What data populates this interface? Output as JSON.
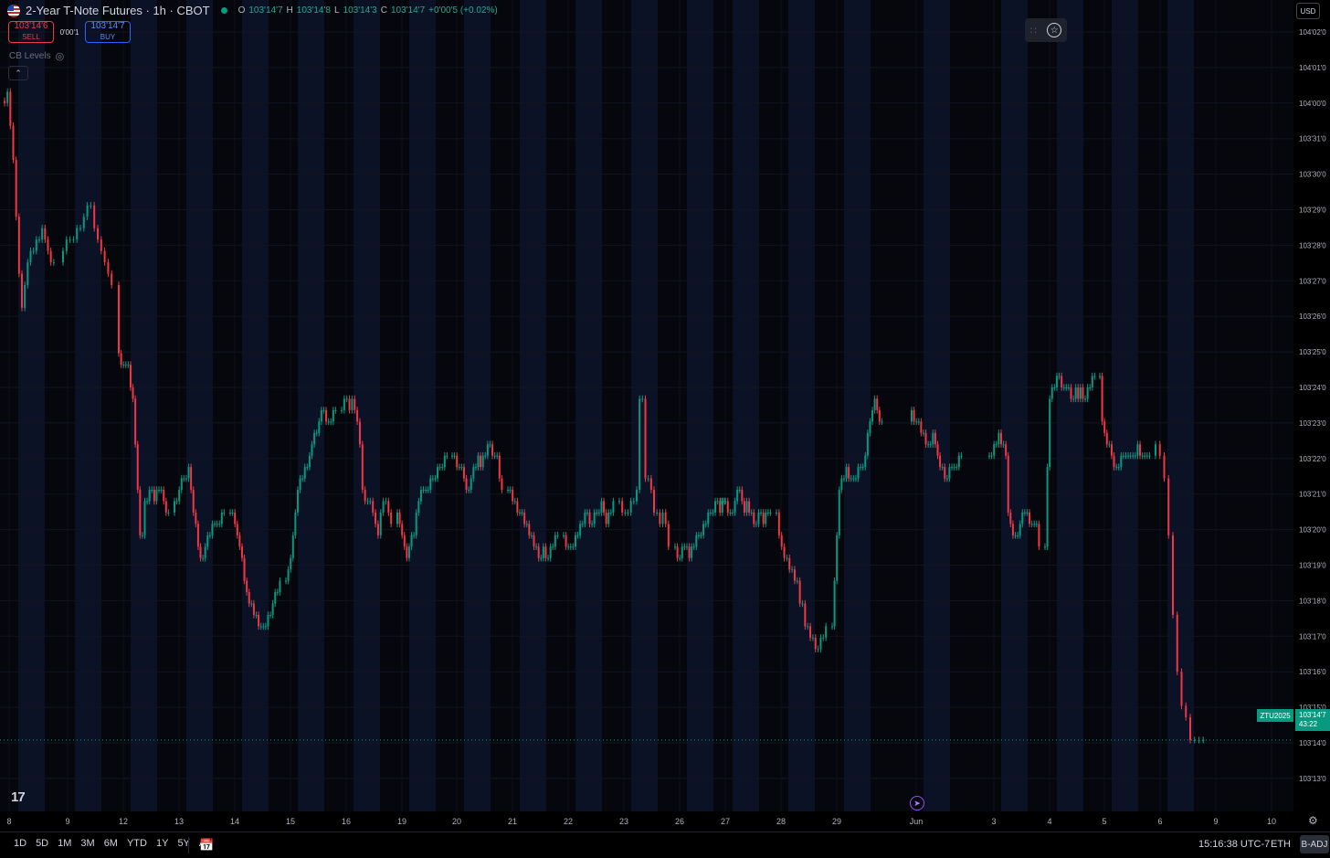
{
  "symbol": {
    "title": "2-Year T-Note Futures · 1h · CBOT",
    "ohlc": [
      {
        "label": "O",
        "value": "103'14'7"
      },
      {
        "label": "H",
        "value": "103'14'8"
      },
      {
        "label": "L",
        "value": "103'14'3"
      },
      {
        "label": "C",
        "value": "103'14'7"
      },
      {
        "label": "",
        "value": "+0'00'5 (+0.02%)"
      }
    ]
  },
  "trade": {
    "sell_price": "103'14'6",
    "sell_label": "SELL",
    "spread": "0'00'1",
    "buy_price": "103'14'7",
    "buy_label": "BUY"
  },
  "indicator": {
    "name": "CB Levels"
  },
  "currency": "USD",
  "tv_logo": "17",
  "last_price": {
    "ticker": "ZTU2025",
    "price": "103'14'7",
    "countdown": "43:22"
  },
  "bottom_bar": {
    "ranges": [
      "1D",
      "5D",
      "1M",
      "3M",
      "6M",
      "YTD",
      "1Y",
      "5Y",
      "All"
    ],
    "clock": "15:16:38 UTC-7",
    "session": "ETH",
    "adjust": "B-ADJ"
  },
  "colors": {
    "up": "#089981",
    "down": "#f23645",
    "background": "#05070d",
    "session_band": "#0b1226"
  },
  "chart_data": {
    "type": "candlestick",
    "timeframe": "1h",
    "y_ticks": [
      "104'02'0",
      "104'01'0",
      "104'00'0",
      "103'31'0",
      "103'30'0",
      "103'29'0",
      "103'28'0",
      "103'27'0",
      "103'26'0",
      "103'25'0",
      "103'24'0",
      "103'23'0",
      "103'22'0",
      "103'21'0",
      "103'20'0",
      "103'19'0",
      "103'18'0",
      "103'17'0",
      "103'16'0",
      "103'15'0",
      "103'14'0",
      "103'13'0"
    ],
    "x_ticks": [
      "8",
      "9",
      "12",
      "13",
      "14",
      "15",
      "16",
      "19",
      "20",
      "21",
      "22",
      "23",
      "26",
      "27",
      "28",
      "29",
      "Jun",
      "3",
      "4",
      "5",
      "6",
      "9",
      "10"
    ],
    "ylim": [
      103.375,
      104.09
    ],
    "grid": true,
    "price_series": [
      {
        "day": "8",
        "points": [
          104.0,
          104.01,
          103.98,
          103.95,
          103.9,
          103.85,
          103.82,
          103.84,
          103.86,
          103.87,
          103.87,
          103.88,
          103.88,
          103.89,
          103.88,
          103.87,
          103.86,
          103.86
        ]
      },
      {
        "day": "9",
        "points": [
          103.87,
          103.88,
          103.88,
          103.88,
          103.89,
          103.89,
          103.9,
          103.91,
          103.91,
          103.89,
          103.88,
          103.87,
          103.86,
          103.85,
          103.84
        ]
      },
      {
        "day": "12",
        "points": [
          103.78,
          103.77,
          103.77,
          103.77,
          103.77,
          103.75,
          103.74,
          103.7,
          103.66,
          103.62,
          103.62,
          103.65,
          103.65,
          103.66,
          103.66,
          103.65,
          103.66,
          103.66,
          103.66,
          103.65,
          103.64,
          103.64
        ]
      },
      {
        "day": "13",
        "points": [
          103.65,
          103.65,
          103.66,
          103.67,
          103.67,
          103.67,
          103.68,
          103.66,
          103.64,
          103.63,
          103.61,
          103.6,
          103.6,
          103.61,
          103.62,
          103.62,
          103.63,
          103.63,
          103.63,
          103.63,
          103.64,
          103.64
        ]
      },
      {
        "day": "14",
        "points": [
          103.64,
          103.64,
          103.63,
          103.62,
          103.61,
          103.6,
          103.58,
          103.57,
          103.56,
          103.56,
          103.55,
          103.55,
          103.54,
          103.54,
          103.54,
          103.54,
          103.55,
          103.55,
          103.56,
          103.57,
          103.57,
          103.58
        ]
      },
      {
        "day": "15",
        "points": [
          103.58,
          103.59,
          103.6,
          103.62,
          103.64,
          103.66,
          103.67,
          103.67,
          103.68,
          103.68,
          103.69,
          103.7,
          103.71,
          103.71,
          103.72,
          103.73,
          103.73,
          103.72,
          103.72,
          103.72,
          103.73,
          103.73
        ]
      },
      {
        "day": "16",
        "points": [
          103.73,
          103.74,
          103.74,
          103.73,
          103.74,
          103.73,
          103.72,
          103.7,
          103.66,
          103.65,
          103.65,
          103.65,
          103.64,
          103.63,
          103.62,
          103.64,
          103.65,
          103.65,
          103.64,
          103.63
        ]
      },
      {
        "day": "19",
        "points": [
          103.64,
          103.63,
          103.62,
          103.61,
          103.6,
          103.61,
          103.62,
          103.62,
          103.64,
          103.65,
          103.66,
          103.66,
          103.66,
          103.66,
          103.67,
          103.67,
          103.67,
          103.68,
          103.68,
          103.68,
          103.69,
          103.69
        ]
      },
      {
        "day": "20",
        "points": [
          103.69,
          103.69,
          103.68,
          103.68,
          103.68,
          103.67,
          103.66,
          103.66,
          103.67,
          103.68,
          103.68,
          103.69,
          103.68,
          103.69,
          103.69,
          103.7,
          103.7,
          103.69,
          103.69,
          103.69,
          103.67,
          103.66
        ]
      },
      {
        "day": "21",
        "points": [
          103.66,
          103.66,
          103.65,
          103.65,
          103.64,
          103.64,
          103.64,
          103.63,
          103.63,
          103.62,
          103.62,
          103.61,
          103.61,
          103.6,
          103.6,
          103.61,
          103.6,
          103.6,
          103.61,
          103.61,
          103.62,
          103.62
        ]
      },
      {
        "day": "22",
        "points": [
          103.62,
          103.61,
          103.61,
          103.61,
          103.61,
          103.62,
          103.62,
          103.63,
          103.63,
          103.64,
          103.64,
          103.63,
          103.63,
          103.64,
          103.64,
          103.64,
          103.65,
          103.64,
          103.63,
          103.64,
          103.64,
          103.65
        ]
      },
      {
        "day": "23",
        "points": [
          103.65,
          103.64,
          103.64,
          103.64,
          103.65,
          103.65,
          103.66,
          103.74,
          103.74,
          103.67,
          103.67,
          103.66,
          103.64,
          103.64,
          103.63,
          103.64,
          103.63,
          103.61
        ]
      },
      {
        "day": "26",
        "points": [
          103.61,
          103.6,
          103.6,
          103.61,
          103.61,
          103.61,
          103.6,
          103.61,
          103.61,
          103.62,
          103.62,
          103.62,
          103.63,
          103.63,
          103.64,
          103.64,
          103.64,
          103.65,
          103.65,
          103.64,
          103.65,
          103.65
        ]
      },
      {
        "day": "27",
        "points": [
          103.65,
          103.65,
          103.65,
          103.64,
          103.64,
          103.64,
          103.65,
          103.66,
          103.66,
          103.65,
          103.64,
          103.65,
          103.64,
          103.64,
          103.63,
          103.63,
          103.64,
          103.64,
          103.63,
          103.64,
          103.64,
          103.64
        ]
      },
      {
        "day": "28",
        "points": [
          103.64,
          103.62,
          103.61,
          103.6,
          103.6,
          103.59,
          103.59,
          103.58,
          103.58,
          103.56,
          103.56,
          103.54,
          103.54,
          103.53,
          103.53,
          103.52,
          103.52,
          103.53,
          103.53,
          103.54
        ]
      },
      {
        "day": "29",
        "points": [
          103.54,
          103.58,
          103.62,
          103.66,
          103.67,
          103.67,
          103.68,
          103.67,
          103.67,
          103.67,
          103.67,
          103.68,
          103.68,
          103.68,
          103.69,
          103.71,
          103.72,
          103.73,
          103.74,
          103.73,
          103.72,
          103.72
        ]
      },
      {
        "day": "Jun",
        "points": [
          103.73,
          103.72,
          103.72,
          103.72,
          103.71,
          103.71,
          103.7,
          103.7,
          103.7,
          103.71,
          103.7,
          103.69,
          103.68,
          103.68,
          103.67,
          103.67,
          103.68,
          103.68,
          103.68,
          103.68,
          103.69,
          103.69
        ]
      },
      {
        "day": "3",
        "points": [
          103.69,
          103.69,
          103.7,
          103.7,
          103.71,
          103.7,
          103.7,
          103.69,
          103.64,
          103.63,
          103.62,
          103.62,
          103.62,
          103.63,
          103.64,
          103.64,
          103.64,
          103.63,
          103.63,
          103.63,
          103.63,
          103.61
        ]
      },
      {
        "day": "4",
        "points": [
          103.61,
          103.68,
          103.74,
          103.75,
          103.75,
          103.76,
          103.76,
          103.75,
          103.75,
          103.75,
          103.75,
          103.74,
          103.74,
          103.75,
          103.74,
          103.75,
          103.74,
          103.74,
          103.75,
          103.75,
          103.76,
          103.76
        ]
      },
      {
        "day": "5",
        "points": [
          103.76,
          103.72,
          103.71,
          103.7,
          103.7,
          103.69,
          103.68,
          103.68,
          103.68,
          103.69,
          103.69,
          103.69,
          103.69,
          103.69,
          103.69,
          103.69,
          103.7,
          103.69,
          103.69,
          103.69,
          103.69,
          103.69
        ]
      },
      {
        "day": "6",
        "points": [
          103.7,
          103.69,
          103.67,
          103.62,
          103.55,
          103.5,
          103.47,
          103.46,
          103.44,
          103.44,
          103.44,
          103.44
        ]
      }
    ]
  }
}
